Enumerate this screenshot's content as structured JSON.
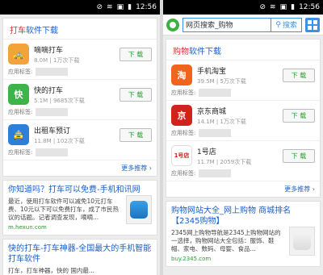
{
  "status": {
    "time": "12:56",
    "icons": [
      "⊘",
      "≋",
      "▣",
      "▮"
    ]
  },
  "left": {
    "card": {
      "title_red": "打车",
      "title_blue": "软件下载",
      "apps": [
        {
          "name": "嘀嘀打车",
          "meta": "8.0M | 1万次下载",
          "btn": "下 载",
          "color": "#f2a43a",
          "glyph": "🚕",
          "usage_label": "应用标签:"
        },
        {
          "name": "快的打车",
          "meta": "5.1M | 9685次下载",
          "btn": "下 载",
          "color": "#3db34a",
          "glyph": "快",
          "usage_label": "应用标签:"
        },
        {
          "name": "出租车预订",
          "meta": "11.8M | 102次下载",
          "btn": "下 载",
          "color": "#2f7fd8",
          "glyph": "🚖",
          "usage_label": "应用标签:"
        }
      ],
      "more": "更多推荐 ›"
    },
    "results": [
      {
        "title": "你知道吗？打车可以免费-手机和讯网",
        "body": "最近，使用打车软件可以减免10元打车费、10元以下可以免费打车，成了市民热议的话题。记者调查发现，嘀嘀...",
        "url": "m.hexun.com"
      },
      {
        "title": "快的打车-打车神器-全国最大的手机智能打车软件",
        "body": "打车，打车神器，快的 国内最..."
      }
    ]
  },
  "right": {
    "search": {
      "value": "网页搜索_购物",
      "button": "搜索"
    },
    "card": {
      "title_red": "购物",
      "title_blue": "软件下载",
      "apps": [
        {
          "name": "手机淘宝",
          "meta": "39.5M | 5万次下载",
          "btn": "下 载",
          "color": "#f0641e",
          "glyph": "淘",
          "usage_label": "应用标签:"
        },
        {
          "name": "京东商城",
          "meta": "14.1M | 1万次下载",
          "btn": "下 载",
          "color": "#d0231c",
          "glyph": "京",
          "usage_label": "应用标签:"
        },
        {
          "name": "1号店",
          "meta": "11.7M | 2059次下载",
          "btn": "下 载",
          "color": "#ffffff",
          "glyph": "1号店",
          "usage_label": "应用标签:"
        }
      ],
      "more": "更多推荐 ›"
    },
    "results": [
      {
        "title": "购物网站大全_网上购物 商城排名【2345购物】",
        "body": "2345网上购物导航是2345上购物网站的一选择，购物网站大全包括：服饰、鞋帽、家电、数码、母婴、食品...",
        "url": "buy.2345.com"
      }
    ]
  }
}
